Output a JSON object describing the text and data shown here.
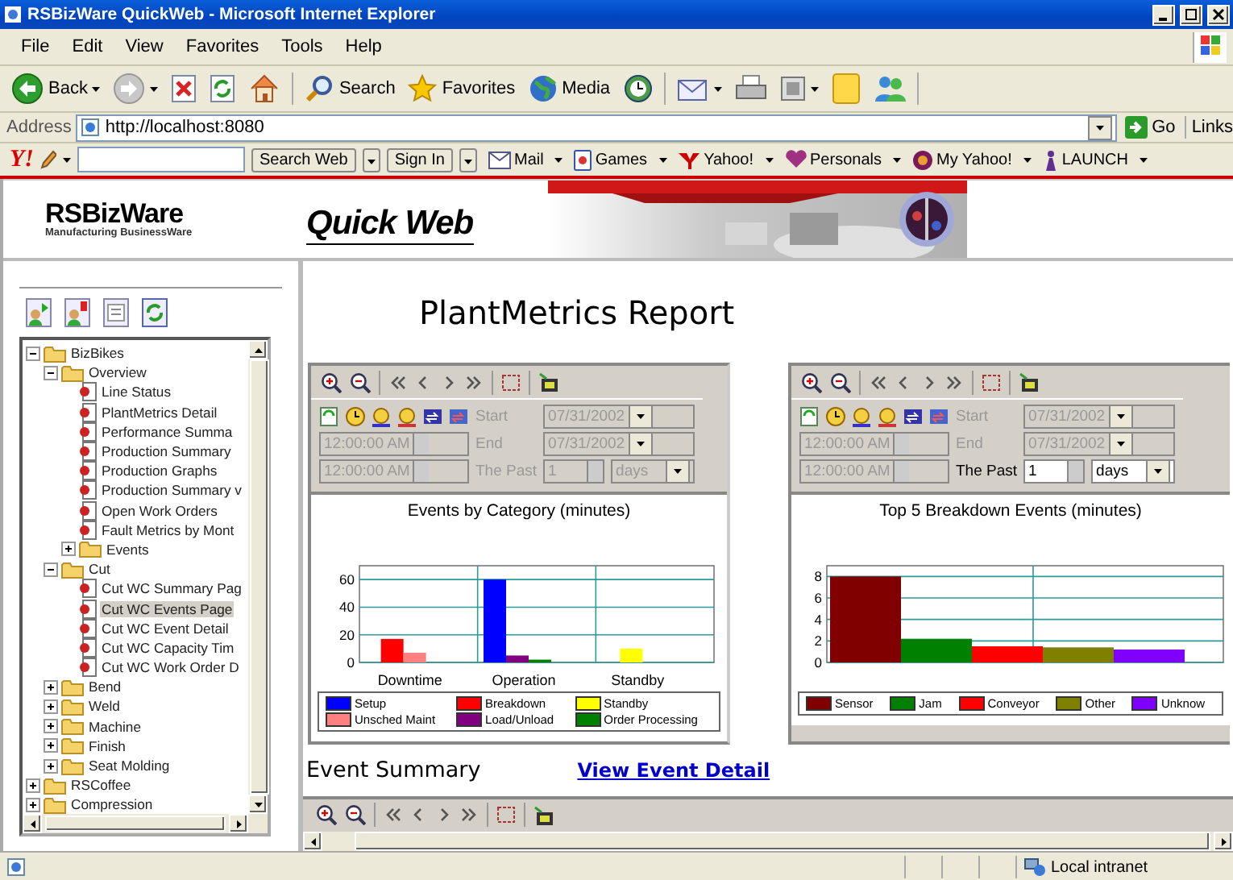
{
  "window": {
    "title": "RSBizWare QuickWeb - Microsoft Internet Explorer"
  },
  "menu": [
    "File",
    "Edit",
    "View",
    "Favorites",
    "Tools",
    "Help"
  ],
  "toolbar": [
    {
      "kind": "back",
      "label": "Back"
    },
    {
      "kind": "forward"
    },
    {
      "kind": "stop"
    },
    {
      "kind": "refresh"
    },
    {
      "kind": "home"
    },
    {
      "kind": "search",
      "label": "Search"
    },
    {
      "kind": "favorites",
      "label": "Favorites"
    },
    {
      "kind": "media",
      "label": "Media"
    },
    {
      "kind": "history"
    },
    {
      "kind": "mail"
    },
    {
      "kind": "print"
    },
    {
      "kind": "edit"
    },
    {
      "kind": "notes"
    },
    {
      "kind": "messenger"
    }
  ],
  "address": {
    "label": "Address",
    "value": "http://localhost:8080",
    "go": "Go",
    "links": "Links"
  },
  "yahoo_bar": {
    "logo": "Y!",
    "search_button": "Search Web",
    "sign_in": "Sign In",
    "items": [
      {
        "kind": "mail",
        "label": "Mail"
      },
      {
        "kind": "games",
        "label": "Games"
      },
      {
        "kind": "yahoo",
        "label": "Yahoo!"
      },
      {
        "kind": "personals",
        "label": "Personals"
      },
      {
        "kind": "myyahoo",
        "label": "My Yahoo!"
      },
      {
        "kind": "launch",
        "label": "LAUNCH"
      }
    ]
  },
  "banner": {
    "logo": "RSBizWare",
    "tagline": "Manufacturing BusinessWare",
    "product": "Quick Web"
  },
  "sidebar": {
    "tree": [
      {
        "label": "BizBikes",
        "kind": "folder",
        "expanded": true,
        "selected": false,
        "children": [
          {
            "label": "Overview",
            "kind": "folder",
            "expanded": true,
            "selected": false,
            "children": [
              {
                "label": "Line Status",
                "kind": "page",
                "selected": false
              },
              {
                "label": "PlantMetrics Detail",
                "kind": "page",
                "selected": false
              },
              {
                "label": "Performance Summa",
                "kind": "page",
                "selected": false
              },
              {
                "label": "Production Summary",
                "kind": "page",
                "selected": false
              },
              {
                "label": "Production Graphs",
                "kind": "page",
                "selected": false
              },
              {
                "label": "Production Summary v",
                "kind": "page",
                "selected": false
              },
              {
                "label": "Open Work Orders",
                "kind": "page",
                "selected": false
              },
              {
                "label": "Fault Metrics by Mont",
                "kind": "page",
                "selected": false
              },
              {
                "label": "Events",
                "kind": "folder",
                "expanded": false,
                "selected": false
              }
            ]
          },
          {
            "label": "Cut",
            "kind": "folder",
            "expanded": true,
            "selected": false,
            "children": [
              {
                "label": "Cut WC Summary Pag",
                "kind": "page",
                "selected": false
              },
              {
                "label": "Cut WC Events Page",
                "kind": "page",
                "selected": true
              },
              {
                "label": "Cut WC Event Detail",
                "kind": "page",
                "selected": false
              },
              {
                "label": "Cut WC Capacity Tim",
                "kind": "page",
                "selected": false
              },
              {
                "label": "Cut WC Work Order D",
                "kind": "page",
                "selected": false
              }
            ]
          },
          {
            "label": "Bend",
            "kind": "folder",
            "expanded": false,
            "selected": false
          },
          {
            "label": "Weld",
            "kind": "folder",
            "expanded": false,
            "selected": false
          },
          {
            "label": "Machine",
            "kind": "folder",
            "expanded": false,
            "selected": false
          },
          {
            "label": "Finish",
            "kind": "folder",
            "expanded": false,
            "selected": false
          },
          {
            "label": "Seat Molding",
            "kind": "folder",
            "expanded": false,
            "selected": false
          }
        ]
      },
      {
        "label": "RSCoffee",
        "kind": "folder",
        "expanded": false,
        "selected": false
      },
      {
        "label": "Compression",
        "kind": "folder",
        "expanded": false,
        "selected": false
      }
    ]
  },
  "report": {
    "title": "PlantMetrics Report",
    "panels": [
      {
        "controls": {
          "start_label": "Start",
          "start_date": "07/31/2002",
          "end_label": "End",
          "end_date": "07/31/2002",
          "time_1": "12:00:00 AM",
          "time_2": "12:00:00 AM",
          "past_label": "The Past",
          "past_value": "1",
          "past_unit": "days",
          "past_disabled": true
        },
        "chart_data": {
          "type": "bar",
          "title": "Events by Category (minutes)",
          "categories": [
            "Downtime",
            "Operation",
            "Standby"
          ],
          "ylim": [
            0,
            70
          ],
          "yticks": [
            0,
            20,
            40,
            60
          ],
          "grid": true,
          "legend": "bottom",
          "series": [
            {
              "name": "Setup",
              "color": "#0000ff",
              "values": [
                null,
                60,
                null
              ]
            },
            {
              "name": "Breakdown",
              "color": "#ff0000",
              "values": [
                17,
                null,
                null
              ]
            },
            {
              "name": "Standby",
              "color": "#ffff00",
              "values": [
                null,
                null,
                10
              ]
            },
            {
              "name": "Unsched Maint",
              "color": "#ff8080",
              "values": [
                7,
                null,
                null
              ]
            },
            {
              "name": "Load/Unload",
              "color": "#800080",
              "values": [
                null,
                5,
                null
              ]
            },
            {
              "name": "Order Processing",
              "color": "#008000",
              "values": [
                null,
                2,
                null
              ]
            }
          ]
        }
      },
      {
        "controls": {
          "start_label": "Start",
          "start_date": "07/31/2002",
          "end_label": "End",
          "end_date": "07/31/2002",
          "time_1": "12:00:00 AM",
          "time_2": "12:00:00 AM",
          "past_label": "The Past",
          "past_value": "1",
          "past_unit": "days",
          "past_disabled": false
        },
        "chart_data": {
          "type": "bar",
          "title": "Top 5 Breakdown Events (minutes)",
          "ylim": [
            0,
            9
          ],
          "yticks": [
            0,
            2,
            4,
            6,
            8
          ],
          "grid": true,
          "legend": "bottom",
          "series": [
            {
              "name": "Sensor",
              "color": "#800000",
              "values": [
                8
              ]
            },
            {
              "name": "Jam",
              "color": "#008000",
              "values": [
                2.2
              ]
            },
            {
              "name": "Conveyor",
              "color": "#ff0000",
              "values": [
                1.5
              ]
            },
            {
              "name": "Other",
              "color": "#808000",
              "values": [
                1.4
              ]
            },
            {
              "name": "Unknow",
              "color": "#8000ff",
              "values": [
                1.2
              ]
            }
          ]
        }
      }
    ],
    "summary_label": "Event Summary",
    "detail_link": "View Event Detail"
  },
  "status_bar": {
    "zone": "Local intranet"
  }
}
